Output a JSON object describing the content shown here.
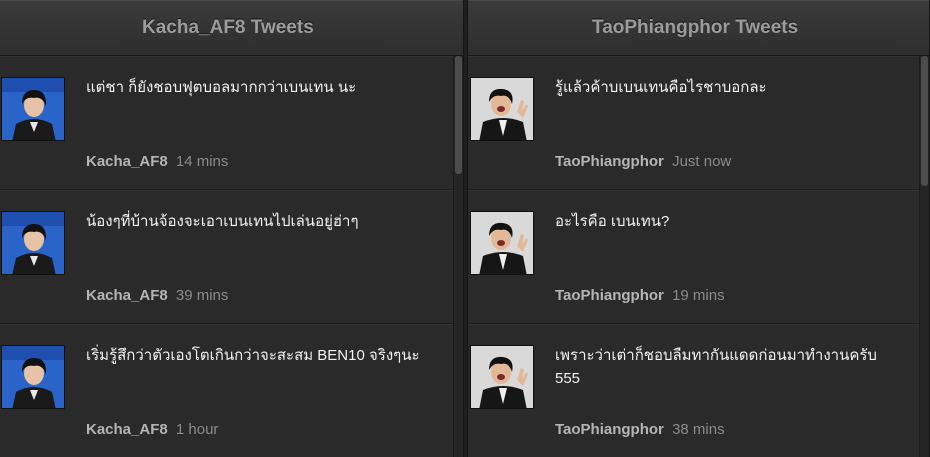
{
  "columns": [
    {
      "title": "Kacha_AF8 Tweets",
      "tweets": [
        {
          "text": "แต่ชา ก็ยังชอบฟุตบอลมากกว่าเบนเทน นะ",
          "user": "Kacha_AF8",
          "time": "14 mins"
        },
        {
          "text": "น้องๆที่บ้านจ้องจะเอาเบนเทนไปเล่นอยู่ฮ่าๆ",
          "user": "Kacha_AF8",
          "time": "39 mins"
        },
        {
          "text": "เริ่มรู้สึกว่าตัวเองโตเกินกว่าจะสะสม BEN10 จริงๆนะ",
          "user": "Kacha_AF8",
          "time": "1 hour"
        }
      ]
    },
    {
      "title": "TaoPhiangphor Tweets",
      "tweets": [
        {
          "text": "รู้แล้วค้าบเบนเทนคือไรชาบอกละ",
          "user": "TaoPhiangphor",
          "time": "Just now"
        },
        {
          "text": "อะไรคือ เบนเทน?",
          "user": "TaoPhiangphor",
          "time": "19 mins"
        },
        {
          "text": "เพราะว่าเต่าก็ชอบลืมทากันแดดก่อนมาทำงานครับ 555",
          "user": "TaoPhiangphor",
          "time": "38 mins"
        }
      ]
    }
  ],
  "colors": {
    "panel": "#2a2a2a",
    "header": "#343434",
    "header_text": "#9c9c9c",
    "tweet_text": "#f2f2f2",
    "username": "#b5b5b5",
    "timestamp": "#8b8b8b",
    "avatar_kacha_bg": "#2b64c8",
    "avatar_tao_bg": "#d9d9d9"
  },
  "icons": {
    "left_avatar": "avatar-photo",
    "right_avatar": "avatar-photo"
  }
}
